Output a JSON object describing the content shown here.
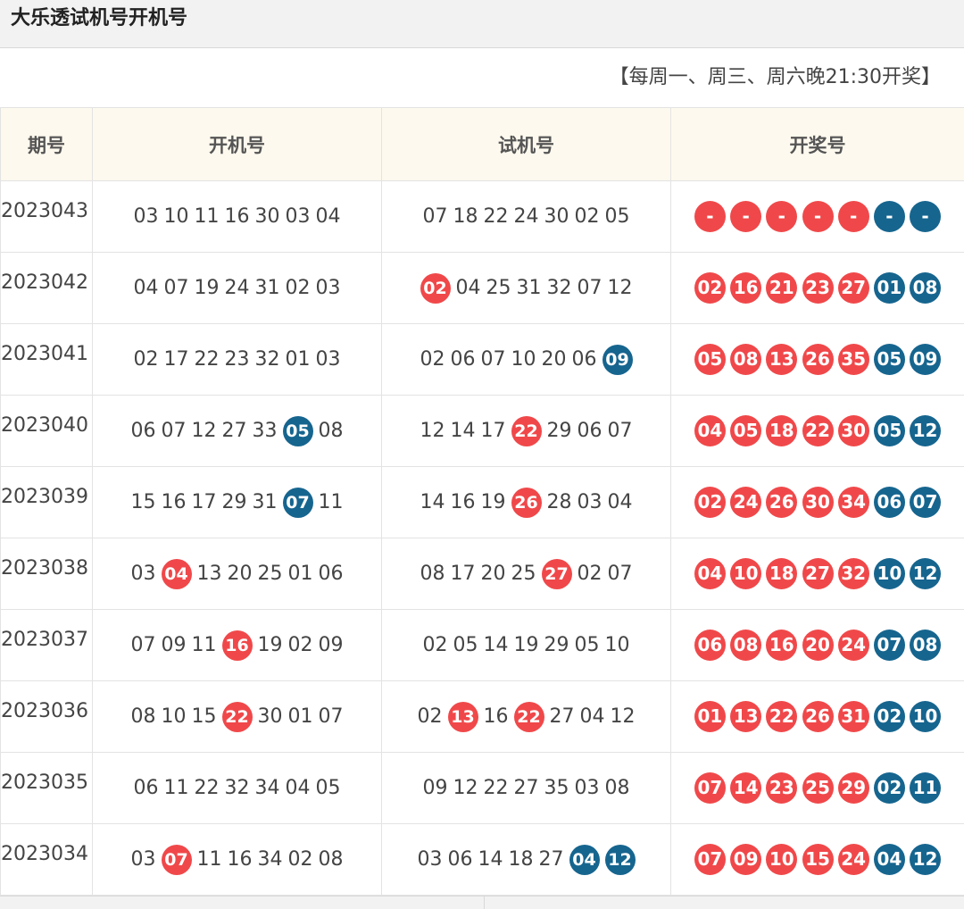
{
  "page": {
    "title": "大乐透试机号开机号"
  },
  "schedule": "【每周一、周三、周六晚21:30开奖】",
  "colors": {
    "front": "#f0484a",
    "back": "#16658f",
    "header_bg": "#fdf9ee"
  },
  "table": {
    "headers": [
      "期号",
      "开机号",
      "试机号",
      "开奖号"
    ],
    "rows": [
      {
        "period": "2023043",
        "open": [
          [
            "03",
            "n"
          ],
          [
            "10",
            "n"
          ],
          [
            "11",
            "n"
          ],
          [
            "16",
            "n"
          ],
          [
            "30",
            "n"
          ],
          [
            "03",
            "n"
          ],
          [
            "04",
            "n"
          ]
        ],
        "trial": [
          [
            "07",
            "n"
          ],
          [
            "18",
            "n"
          ],
          [
            "22",
            "n"
          ],
          [
            "24",
            "n"
          ],
          [
            "30",
            "n"
          ],
          [
            "02",
            "n"
          ],
          [
            "05",
            "n"
          ]
        ],
        "draw": [
          [
            "-",
            "r"
          ],
          [
            "-",
            "r"
          ],
          [
            "-",
            "r"
          ],
          [
            "-",
            "r"
          ],
          [
            "-",
            "r"
          ],
          [
            "-",
            "b"
          ],
          [
            "-",
            "b"
          ]
        ]
      },
      {
        "period": "2023042",
        "open": [
          [
            "04",
            "n"
          ],
          [
            "07",
            "n"
          ],
          [
            "19",
            "n"
          ],
          [
            "24",
            "n"
          ],
          [
            "31",
            "n"
          ],
          [
            "02",
            "n"
          ],
          [
            "03",
            "n"
          ]
        ],
        "trial": [
          [
            "02",
            "r"
          ],
          [
            "04",
            "n"
          ],
          [
            "25",
            "n"
          ],
          [
            "31",
            "n"
          ],
          [
            "32",
            "n"
          ],
          [
            "07",
            "n"
          ],
          [
            "12",
            "n"
          ]
        ],
        "draw": [
          [
            "02",
            "r"
          ],
          [
            "16",
            "r"
          ],
          [
            "21",
            "r"
          ],
          [
            "23",
            "r"
          ],
          [
            "27",
            "r"
          ],
          [
            "01",
            "b"
          ],
          [
            "08",
            "b"
          ]
        ]
      },
      {
        "period": "2023041",
        "open": [
          [
            "02",
            "n"
          ],
          [
            "17",
            "n"
          ],
          [
            "22",
            "n"
          ],
          [
            "23",
            "n"
          ],
          [
            "32",
            "n"
          ],
          [
            "01",
            "n"
          ],
          [
            "03",
            "n"
          ]
        ],
        "trial": [
          [
            "02",
            "n"
          ],
          [
            "06",
            "n"
          ],
          [
            "07",
            "n"
          ],
          [
            "10",
            "n"
          ],
          [
            "20",
            "n"
          ],
          [
            "06",
            "n"
          ],
          [
            "09",
            "b"
          ]
        ],
        "draw": [
          [
            "05",
            "r"
          ],
          [
            "08",
            "r"
          ],
          [
            "13",
            "r"
          ],
          [
            "26",
            "r"
          ],
          [
            "35",
            "r"
          ],
          [
            "05",
            "b"
          ],
          [
            "09",
            "b"
          ]
        ]
      },
      {
        "period": "2023040",
        "open": [
          [
            "06",
            "n"
          ],
          [
            "07",
            "n"
          ],
          [
            "12",
            "n"
          ],
          [
            "27",
            "n"
          ],
          [
            "33",
            "n"
          ],
          [
            "05",
            "b"
          ],
          [
            "08",
            "n"
          ]
        ],
        "trial": [
          [
            "12",
            "n"
          ],
          [
            "14",
            "n"
          ],
          [
            "17",
            "n"
          ],
          [
            "22",
            "r"
          ],
          [
            "29",
            "n"
          ],
          [
            "06",
            "n"
          ],
          [
            "07",
            "n"
          ]
        ],
        "draw": [
          [
            "04",
            "r"
          ],
          [
            "05",
            "r"
          ],
          [
            "18",
            "r"
          ],
          [
            "22",
            "r"
          ],
          [
            "30",
            "r"
          ],
          [
            "05",
            "b"
          ],
          [
            "12",
            "b"
          ]
        ]
      },
      {
        "period": "2023039",
        "open": [
          [
            "15",
            "n"
          ],
          [
            "16",
            "n"
          ],
          [
            "17",
            "n"
          ],
          [
            "29",
            "n"
          ],
          [
            "31",
            "n"
          ],
          [
            "07",
            "b"
          ],
          [
            "11",
            "n"
          ]
        ],
        "trial": [
          [
            "14",
            "n"
          ],
          [
            "16",
            "n"
          ],
          [
            "19",
            "n"
          ],
          [
            "26",
            "r"
          ],
          [
            "28",
            "n"
          ],
          [
            "03",
            "n"
          ],
          [
            "04",
            "n"
          ]
        ],
        "draw": [
          [
            "02",
            "r"
          ],
          [
            "24",
            "r"
          ],
          [
            "26",
            "r"
          ],
          [
            "30",
            "r"
          ],
          [
            "34",
            "r"
          ],
          [
            "06",
            "b"
          ],
          [
            "07",
            "b"
          ]
        ]
      },
      {
        "period": "2023038",
        "open": [
          [
            "03",
            "n"
          ],
          [
            "04",
            "r"
          ],
          [
            "13",
            "n"
          ],
          [
            "20",
            "n"
          ],
          [
            "25",
            "n"
          ],
          [
            "01",
            "n"
          ],
          [
            "06",
            "n"
          ]
        ],
        "trial": [
          [
            "08",
            "n"
          ],
          [
            "17",
            "n"
          ],
          [
            "20",
            "n"
          ],
          [
            "25",
            "n"
          ],
          [
            "27",
            "r"
          ],
          [
            "02",
            "n"
          ],
          [
            "07",
            "n"
          ]
        ],
        "draw": [
          [
            "04",
            "r"
          ],
          [
            "10",
            "r"
          ],
          [
            "18",
            "r"
          ],
          [
            "27",
            "r"
          ],
          [
            "32",
            "r"
          ],
          [
            "10",
            "b"
          ],
          [
            "12",
            "b"
          ]
        ]
      },
      {
        "period": "2023037",
        "open": [
          [
            "07",
            "n"
          ],
          [
            "09",
            "n"
          ],
          [
            "11",
            "n"
          ],
          [
            "16",
            "r"
          ],
          [
            "19",
            "n"
          ],
          [
            "02",
            "n"
          ],
          [
            "09",
            "n"
          ]
        ],
        "trial": [
          [
            "02",
            "n"
          ],
          [
            "05",
            "n"
          ],
          [
            "14",
            "n"
          ],
          [
            "19",
            "n"
          ],
          [
            "29",
            "n"
          ],
          [
            "05",
            "n"
          ],
          [
            "10",
            "n"
          ]
        ],
        "draw": [
          [
            "06",
            "r"
          ],
          [
            "08",
            "r"
          ],
          [
            "16",
            "r"
          ],
          [
            "20",
            "r"
          ],
          [
            "24",
            "r"
          ],
          [
            "07",
            "b"
          ],
          [
            "08",
            "b"
          ]
        ]
      },
      {
        "period": "2023036",
        "open": [
          [
            "08",
            "n"
          ],
          [
            "10",
            "n"
          ],
          [
            "15",
            "n"
          ],
          [
            "22",
            "r"
          ],
          [
            "30",
            "n"
          ],
          [
            "01",
            "n"
          ],
          [
            "07",
            "n"
          ]
        ],
        "trial": [
          [
            "02",
            "n"
          ],
          [
            "13",
            "r"
          ],
          [
            "16",
            "n"
          ],
          [
            "22",
            "r"
          ],
          [
            "27",
            "n"
          ],
          [
            "04",
            "n"
          ],
          [
            "12",
            "n"
          ]
        ],
        "draw": [
          [
            "01",
            "r"
          ],
          [
            "13",
            "r"
          ],
          [
            "22",
            "r"
          ],
          [
            "26",
            "r"
          ],
          [
            "31",
            "r"
          ],
          [
            "02",
            "b"
          ],
          [
            "10",
            "b"
          ]
        ]
      },
      {
        "period": "2023035",
        "open": [
          [
            "06",
            "n"
          ],
          [
            "11",
            "n"
          ],
          [
            "22",
            "n"
          ],
          [
            "32",
            "n"
          ],
          [
            "34",
            "n"
          ],
          [
            "04",
            "n"
          ],
          [
            "05",
            "n"
          ]
        ],
        "trial": [
          [
            "09",
            "n"
          ],
          [
            "12",
            "n"
          ],
          [
            "22",
            "n"
          ],
          [
            "27",
            "n"
          ],
          [
            "35",
            "n"
          ],
          [
            "03",
            "n"
          ],
          [
            "08",
            "n"
          ]
        ],
        "draw": [
          [
            "07",
            "r"
          ],
          [
            "14",
            "r"
          ],
          [
            "23",
            "r"
          ],
          [
            "25",
            "r"
          ],
          [
            "29",
            "r"
          ],
          [
            "02",
            "b"
          ],
          [
            "11",
            "b"
          ]
        ]
      },
      {
        "period": "2023034",
        "open": [
          [
            "03",
            "n"
          ],
          [
            "07",
            "r"
          ],
          [
            "11",
            "n"
          ],
          [
            "16",
            "n"
          ],
          [
            "34",
            "n"
          ],
          [
            "02",
            "n"
          ],
          [
            "08",
            "n"
          ]
        ],
        "trial": [
          [
            "03",
            "n"
          ],
          [
            "06",
            "n"
          ],
          [
            "14",
            "n"
          ],
          [
            "18",
            "n"
          ],
          [
            "27",
            "n"
          ],
          [
            "04",
            "b"
          ],
          [
            "12",
            "b"
          ]
        ],
        "draw": [
          [
            "07",
            "r"
          ],
          [
            "09",
            "r"
          ],
          [
            "10",
            "r"
          ],
          [
            "15",
            "r"
          ],
          [
            "24",
            "r"
          ],
          [
            "04",
            "b"
          ],
          [
            "12",
            "b"
          ]
        ]
      }
    ]
  }
}
